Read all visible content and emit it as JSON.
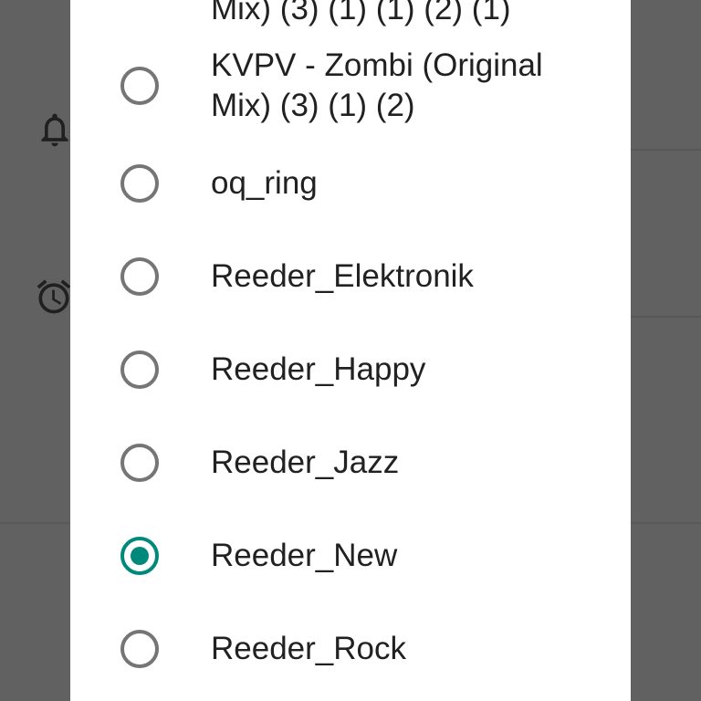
{
  "background": {
    "icons": [
      "bell-icon",
      "alarm-clock-icon"
    ]
  },
  "dialog": {
    "selected_index": 6,
    "accent_color": "#00897b",
    "options": [
      {
        "label": "Mix) (3) (1) (1) (2) (1)"
      },
      {
        "label": "KVPV - Zombi (Original Mix) (3) (1) (2)"
      },
      {
        "label": "oq_ring"
      },
      {
        "label": "Reeder_Elektronik"
      },
      {
        "label": "Reeder_Happy"
      },
      {
        "label": "Reeder_Jazz"
      },
      {
        "label": "Reeder_New"
      },
      {
        "label": "Reeder_Rock"
      }
    ]
  }
}
